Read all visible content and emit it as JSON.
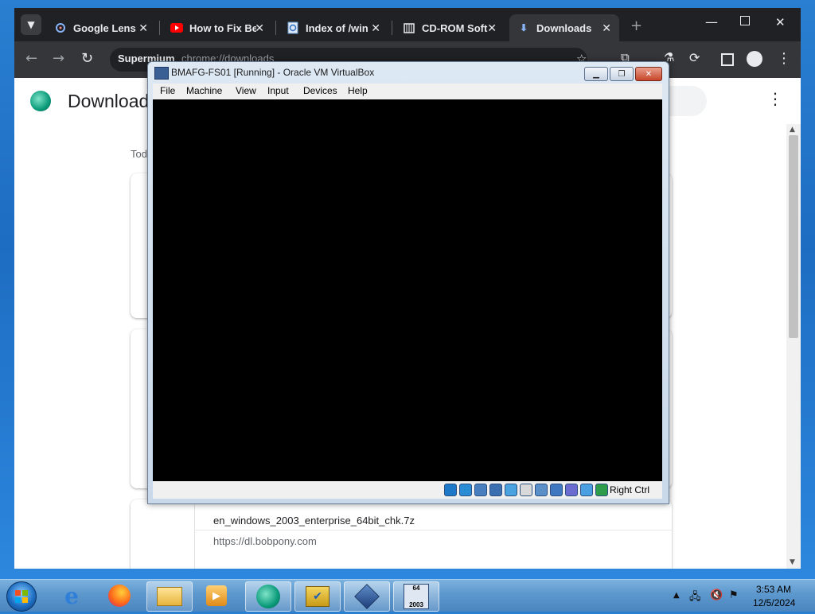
{
  "browser": {
    "tabs": [
      {
        "label": "Google Lens",
        "icon": "google-lens-icon"
      },
      {
        "label": "How to Fix Be",
        "icon": "youtube-icon"
      },
      {
        "label": "Index of /win",
        "icon": "ie-page-icon"
      },
      {
        "label": "CD-ROM Soft",
        "icon": "archive-icon"
      },
      {
        "label": "Downloads",
        "icon": "download-icon"
      }
    ],
    "omnibox_chip": "Supermium",
    "url": "chrome://downloads",
    "page_title": "Downloads",
    "today_label": "Today",
    "download_item": {
      "filename": "en_windows_2003_enterprise_64bit_chk.7z",
      "source_url": "https://dl.bobpony.com"
    }
  },
  "vbox": {
    "title": "BMAFG-FS01 [Running] - Oracle VM VirtualBox",
    "menus": [
      "File",
      "Machine",
      "View",
      "Input",
      "Devices",
      "Help"
    ],
    "host_key": "Right Ctrl",
    "status_icon_colors": [
      "#1e78c8",
      "#2a8cd4",
      "#4a7fbf",
      "#3b6fb0",
      "#4aa3df",
      "#d9d9d9",
      "#5a8fc8",
      "#3f78c0",
      "#6b6bd0",
      "#4aa0e0",
      "#2e9c4a"
    ]
  },
  "taskbar": {
    "clock_time": "3:53 AM",
    "clock_date": "12/5/2024"
  }
}
